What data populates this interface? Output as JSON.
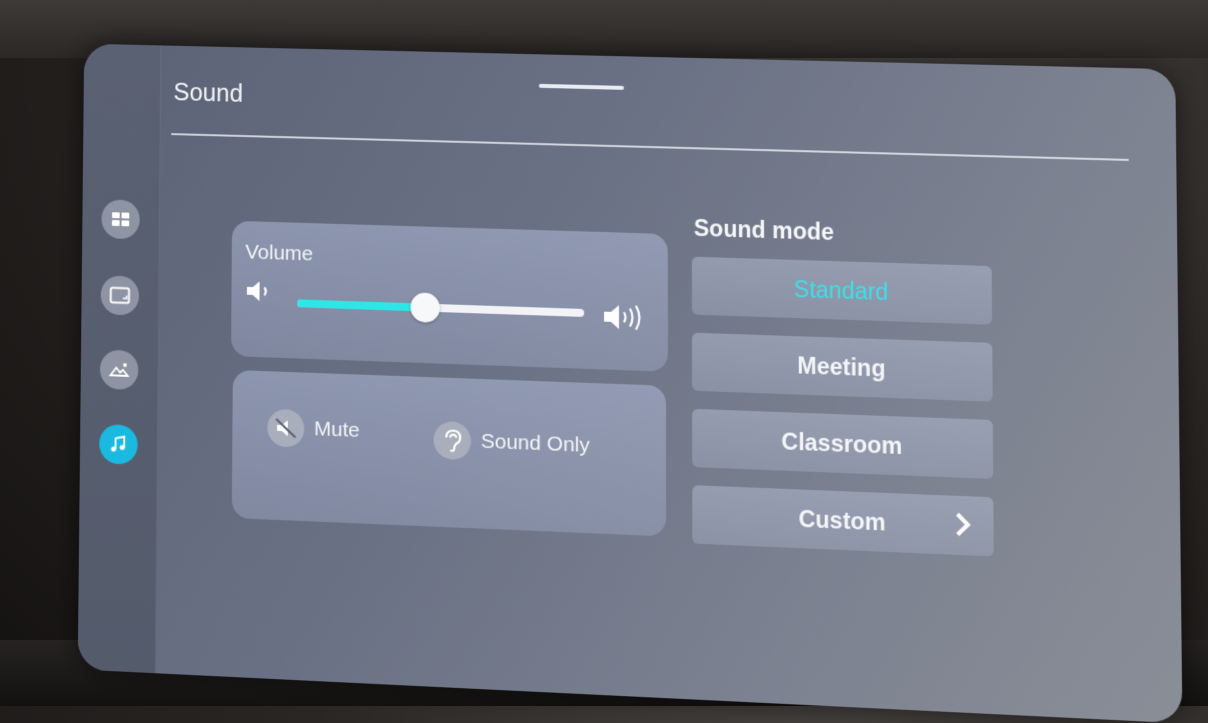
{
  "header": {
    "title": "Sound"
  },
  "sidebar": {
    "items": [
      {
        "name": "general",
        "icon": "grid-icon",
        "active": false
      },
      {
        "name": "display",
        "icon": "screen-icon",
        "active": false
      },
      {
        "name": "picture",
        "icon": "image-icon",
        "active": false
      },
      {
        "name": "sound",
        "icon": "music-note-icon",
        "active": true
      }
    ]
  },
  "volume": {
    "label": "Volume",
    "level_percent": 45
  },
  "sound_options": {
    "mute_label": "Mute",
    "sound_only_label": "Sound Only"
  },
  "sound_mode": {
    "title": "Sound mode",
    "options": [
      "Standard",
      "Meeting",
      "Classroom",
      "Custom"
    ],
    "selected": "Standard"
  },
  "colors": {
    "accent": "#19b9e0",
    "selected_text": "#3ce0ea",
    "slider_fill": "#2ee6e6"
  }
}
